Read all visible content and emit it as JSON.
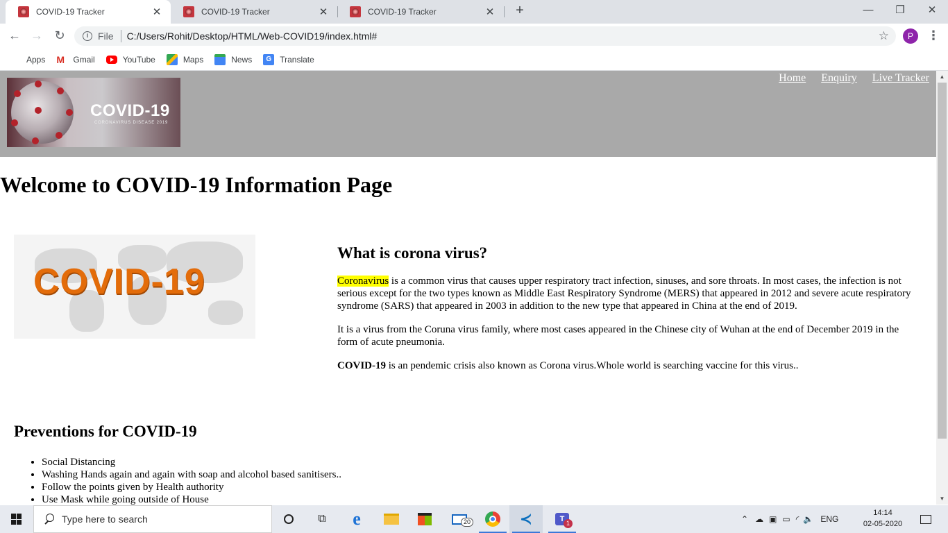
{
  "browser": {
    "tabs": [
      {
        "title": "COVID-19 Tracker",
        "active": true
      },
      {
        "title": "COVID-19 Tracker",
        "active": false
      },
      {
        "title": "COVID-19 Tracker",
        "active": false
      }
    ],
    "new_tab_label": "+",
    "window_controls": {
      "minimize": "—",
      "restore": "❐",
      "close": "✕"
    },
    "nav": {
      "back": "←",
      "forward": "→",
      "reload": "↻"
    },
    "address": {
      "scheme_label": "File",
      "url": "C:/Users/Rohit/Desktop/HTML/Web-COVID19/index.html#"
    },
    "profile_initial": "P",
    "bookmarks": [
      {
        "label": "Apps",
        "icon": "apps-grid-icon"
      },
      {
        "label": "Gmail",
        "icon": "gmail-icon"
      },
      {
        "label": "YouTube",
        "icon": "youtube-icon"
      },
      {
        "label": "Maps",
        "icon": "maps-icon"
      },
      {
        "label": "News",
        "icon": "news-icon"
      },
      {
        "label": "Translate",
        "icon": "translate-icon"
      }
    ]
  },
  "page": {
    "header_bg": "#a9a9a9",
    "logo": {
      "brand": "COVID-19",
      "subtitle": "CORONAVIRUS DISEASE 2019"
    },
    "nav_links": [
      "Home",
      "Enquiry",
      "Live Tracker"
    ],
    "heading": "Welcome to COVID-19 Information Page",
    "map_image_text": "COVID-19",
    "about": {
      "title": "What is corona virus?",
      "p1_highlight": "Coronavirus",
      "p1_rest": " is a common virus that causes upper respiratory tract infection, sinuses, and sore throats. In most cases, the infection is not serious except for the two types known as Middle East Respiratory Syndrome (MERS) that appeared in 2012 and severe acute respiratory syndrome (SARS) that appeared in 2003 in addition to the new type that appeared in China at the end of 2019.",
      "p2": "It is a virus from the Coruna virus family, where most cases appeared in the Chinese city of Wuhan at the end of December 2019 in the form of acute pneumonia.",
      "p3_bold": "COVID-19",
      "p3_rest": " is an pendemic crisis also known as Corona virus.Whole world is searching vaccine for this virus.."
    },
    "preventions": {
      "title": "Preventions for COVID-19",
      "items": [
        "Social Distancing",
        "Washing Hands again and again with soap and alcohol based sanitisers..",
        "Follow the points given by Health authority",
        "Use Mask while going outside of House"
      ]
    }
  },
  "taskbar": {
    "search_placeholder": "Type here to search",
    "mail_badge": "20",
    "teams_badge": "1",
    "language": "ENG",
    "time": "14:14",
    "date": "02-05-2020"
  }
}
